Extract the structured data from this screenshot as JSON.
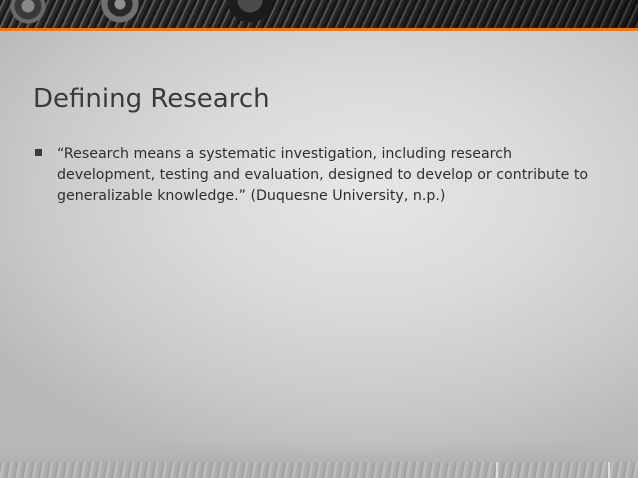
{
  "slide": {
    "title": "Defining Research",
    "bullets": [
      {
        "text": "“Research means a systematic investigation, including research development, testing and evaluation, designed to develop or contribute to generalizable knowledge.”  (Duquesne University, n.p.)"
      }
    ]
  },
  "theme": {
    "accent_color": "#e07a2b",
    "background_color": "#d9d9d9",
    "title_color": "#3a3a3a",
    "text_color": "#2e2e2e",
    "bullet_icon": "square-bullet-icon"
  }
}
